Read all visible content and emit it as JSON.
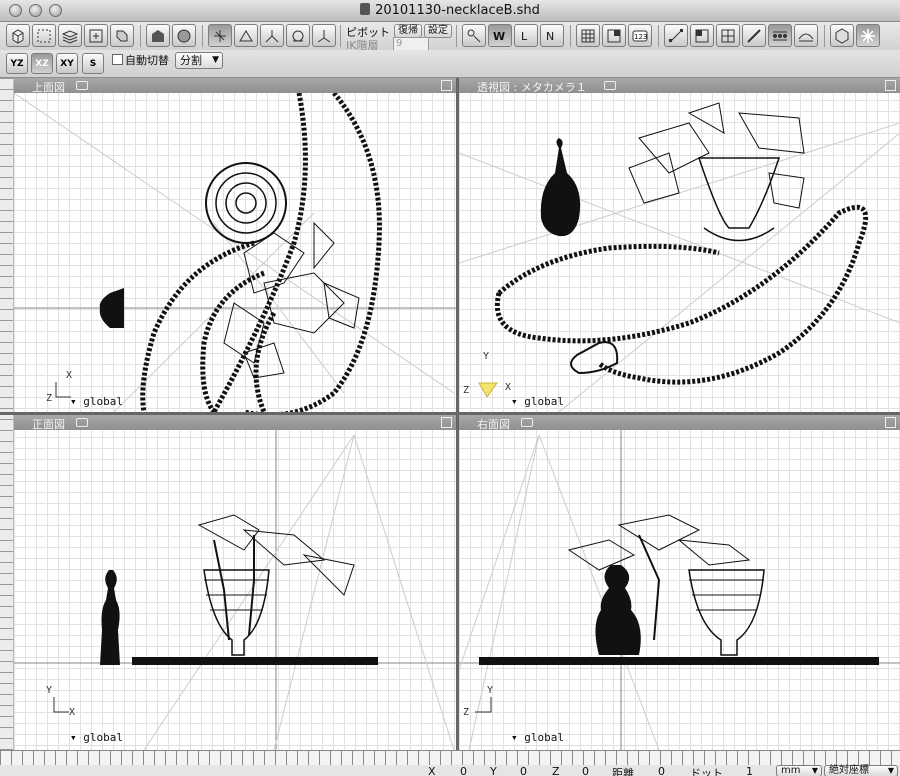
{
  "window": {
    "title": "20101130-necklaceB.shd"
  },
  "toolbar": {
    "pivot_label": "ピボット",
    "restore_label": "復帰",
    "settings_label": "設定",
    "ik_label": "IK階層",
    "ik_value": "9"
  },
  "toolbar2": {
    "view_buttons": [
      "YZ",
      "XZ",
      "XY",
      "S"
    ],
    "auto_switch_label": "自動切替",
    "split_select": "分割"
  },
  "viewports": {
    "top": {
      "title": "上面図",
      "coord": "global",
      "axis_x": "X",
      "axis_y": "Z"
    },
    "perspective": {
      "title": "透視図 : メタカメラ１",
      "coord": "global",
      "axis_x": "X",
      "axis_y": "Y",
      "axis_z": "Z"
    },
    "front": {
      "title": "正面図",
      "coord": "global",
      "axis_x": "X",
      "axis_y": "Y"
    },
    "right": {
      "title": "右面図",
      "coord": "global",
      "axis_x": "Z",
      "axis_y": "Y"
    }
  },
  "statusbar": {
    "x_label": "X",
    "x_value": "0",
    "y_label": "Y",
    "y_value": "0",
    "z_label": "Z",
    "z_value": "0",
    "distance_label": "距離",
    "distance_value": "0",
    "dot_label": "ドット",
    "dot_value": "1",
    "unit_select": "mm",
    "coord_select": "絶対座標"
  }
}
